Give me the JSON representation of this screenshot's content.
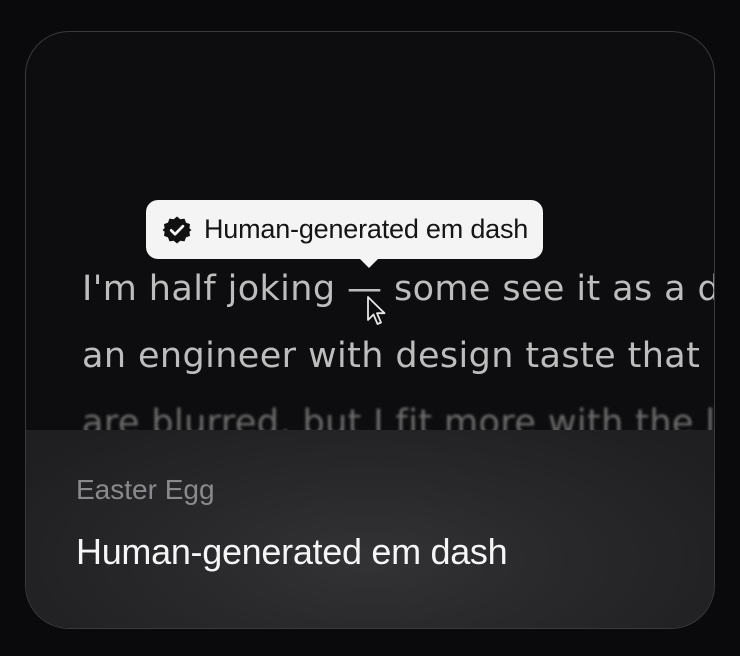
{
  "tooltip": {
    "icon": "verified-badge-icon",
    "label": "Human-generated em dash"
  },
  "passage": {
    "line1_before": "I'm half joking ",
    "line1_dash": "—",
    "line1_after": " some see it as a d",
    "line2": "an engineer with design taste that",
    "line3": "are blurred, but I fit more with the l"
  },
  "cursor": {
    "icon": "pointer-cursor-icon"
  },
  "footer": {
    "kicker": "Easter Egg",
    "title": "Human-generated em dash"
  },
  "colors": {
    "background": "#0a0a0c",
    "card": "#0d0d0f",
    "tooltip_bg": "#f4f4f4",
    "text_muted": "#bdbdbd",
    "footer_title": "#f5f5f5"
  }
}
